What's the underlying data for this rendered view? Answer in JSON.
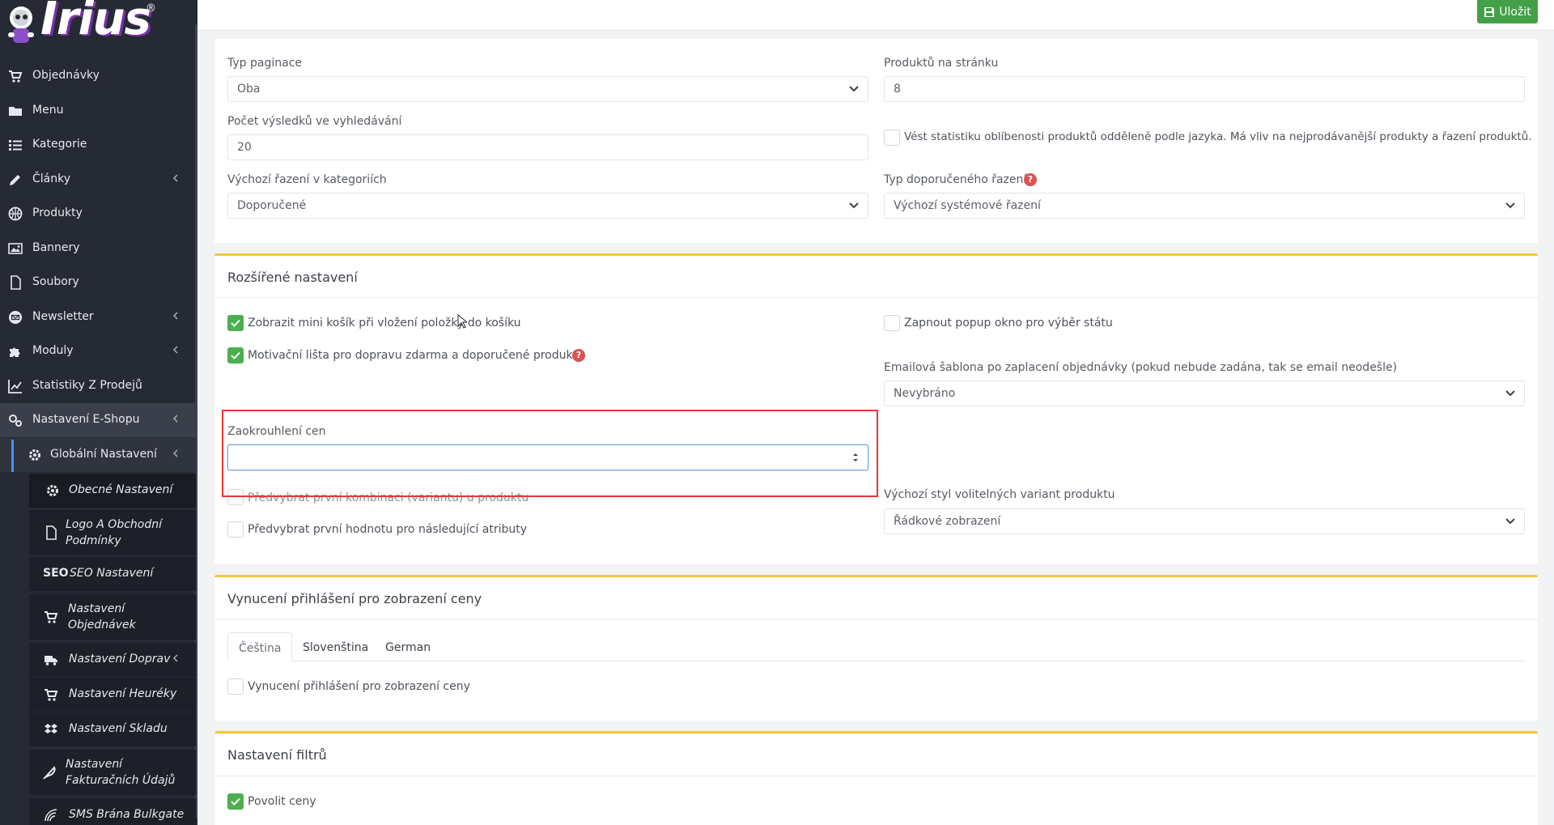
{
  "brand": {
    "logo_text": "Irius",
    "registered": "®"
  },
  "sidebar": {
    "items": [
      {
        "label": "Objednávky",
        "icon": "cart-icon"
      },
      {
        "label": "Menu",
        "icon": "folder-icon"
      },
      {
        "label": "Kategorie",
        "icon": "list-icon"
      },
      {
        "label": "Články",
        "icon": "pencil-icon",
        "has_children": true
      },
      {
        "label": "Produkty",
        "icon": "basketball-icon"
      },
      {
        "label": "Bannery",
        "icon": "image-icon"
      },
      {
        "label": "Soubory",
        "icon": "file-icon"
      },
      {
        "label": "Newsletter",
        "icon": "envelope-icon",
        "has_children": true
      },
      {
        "label": "Moduly",
        "icon": "puzzle-icon",
        "has_children": true
      },
      {
        "label": "Statistiky Z Prodejů",
        "icon": "chart-line-icon"
      },
      {
        "label": "Nastavení E-Shopu",
        "icon": "cogs-icon",
        "has_children": true
      }
    ],
    "global_settings": {
      "label": "Globální Nastavení",
      "icon": "gear-icon"
    },
    "sub_items": [
      {
        "label": "Obecné Nastavení",
        "icon": "gear-icon",
        "active": true
      },
      {
        "label": "Logo A Obchodní Podmínky",
        "line1": "Logo A Obchodní",
        "line2": "Podmínky",
        "icon": "file-icon"
      },
      {
        "label": "SEO Nastavení",
        "prefix": "SEO",
        "icon": "seo-icon"
      },
      {
        "label": "Nastavení Objednávek",
        "line1": "Nastavení",
        "line2": "Objednávek",
        "icon": "cart-icon"
      },
      {
        "label": "Nastavení Doprav",
        "icon": "truck-icon",
        "has_children": true
      },
      {
        "label": "Nastavení Heuréky",
        "icon": "cart-icon"
      },
      {
        "label": "Nastavení Skladu",
        "icon": "dropbox-icon"
      },
      {
        "label": "Nastavení Fakturačních Údajů",
        "line1": "Nastavení",
        "line2": "Fakturačních Údajů",
        "icon": "feather-icon"
      },
      {
        "label": "SMS Brána Bulkgate",
        "icon": "signal-icon"
      }
    ]
  },
  "toolbar": {
    "save_label": "Uložit"
  },
  "general": {
    "pagination_type": {
      "label": "Typ paginace",
      "value": "Oba"
    },
    "products_per_page": {
      "label": "Produktů na stránku",
      "value": "8"
    },
    "search_results": {
      "label": "Počet výsledků ve vyhledávání",
      "value": "20"
    },
    "popularity_stats": {
      "label": "Vést statistiku oblíbenosti produktů odděleně podle jazyka. Má vliv na nejprodávanější produkty a řazení produktů.",
      "checked": false
    },
    "default_sort": {
      "label": "Výchozí řazení v kategoriích",
      "value": "Doporučené"
    },
    "recommended_sort_type": {
      "label": "Typ doporučeného řazení",
      "value": "Výchozí systémové řazení"
    }
  },
  "extended": {
    "title": "Rozšířené nastavení",
    "mini_cart": {
      "label": "Zobrazit mini košík při vložení položky do košíku",
      "checked": true
    },
    "motivation_bar": {
      "label": "Motivační lišta pro dopravu zdarma a doporučené produkty",
      "checked": true
    },
    "state_popup": {
      "label": "Zapnout popup okno pro výběr státu",
      "checked": false
    },
    "email_template": {
      "label": "Emailová šablona po zaplacení objednávky (pokud nebude zadána, tak se email neodešle)",
      "value": "Nevybráno"
    },
    "price_rounding": {
      "label": "Zaokrouhlení cen",
      "value": ""
    },
    "preselect_combination": {
      "label": "Předvybrat první kombinaci (variantu) u produktu",
      "checked": false
    },
    "preselect_attribute": {
      "label": "Předvybrat první hodnotu pro následující atributy",
      "checked": false
    },
    "variant_style": {
      "label": "Výchozí styl volitelných variant produktu",
      "value": "Řádkové zobrazení"
    }
  },
  "login_required": {
    "title": "Vynucení přihlášení pro zobrazení ceny",
    "tabs": [
      "Čeština",
      "Slovenština",
      "German"
    ],
    "active_tab": 0,
    "checkbox": {
      "label": "Vynucení přihlášení pro zobrazení ceny",
      "checked": false
    }
  },
  "filters": {
    "title": "Nastavení filtrů",
    "allow_prices": {
      "label": "Povolit ceny",
      "checked": true
    }
  },
  "colors": {
    "sidebar": "#262a35",
    "accent": "#f5c53a",
    "success": "#43a047",
    "highlight": "#e53935"
  }
}
